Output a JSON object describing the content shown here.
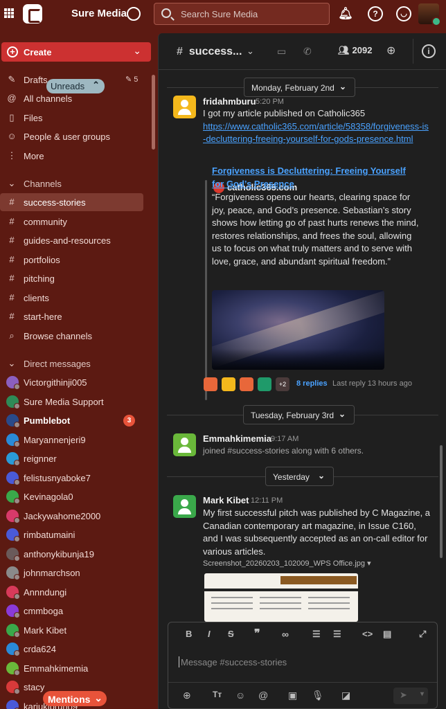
{
  "app": {
    "team_name": "Sure Media"
  },
  "search": {
    "placeholder": "Search Sure Media"
  },
  "topbar": {
    "notification_icon": "bell-icon",
    "help_label": "?",
    "emoji_icon": "smiley-icon"
  },
  "sidebar": {
    "create_label": "Create",
    "unreads_label": "Unreads",
    "drafts_label": "Drafts",
    "drafts_count": "5",
    "nav": [
      {
        "label": "All channels",
        "icon": "@"
      },
      {
        "label": "Files",
        "icon": "▯"
      },
      {
        "label": "People & user groups",
        "icon": "☺"
      },
      {
        "label": "More",
        "icon": "⋮"
      }
    ],
    "channels_header": "Channels",
    "channels": [
      {
        "label": "success-stories",
        "active": true
      },
      {
        "label": "community"
      },
      {
        "label": "guides-and-resources"
      },
      {
        "label": "portfolios"
      },
      {
        "label": "pitching"
      },
      {
        "label": "clients"
      },
      {
        "label": "start-here"
      }
    ],
    "browse_channels": "Browse channels",
    "dm_header": "Direct messages",
    "dms": [
      {
        "label": "Victorgithinji005",
        "color": "#8b5fbf"
      },
      {
        "label": "Sure Media Support",
        "color": "#2e8b57"
      },
      {
        "label": "Pumblebot",
        "color": "#2a4a8a",
        "bold": true,
        "badge": "3"
      },
      {
        "label": "Maryannenjeri9",
        "color": "#2a8ad8"
      },
      {
        "label": "reignner",
        "color": "#2a9ad8"
      },
      {
        "label": "felistusnyaboke7",
        "color": "#4a5ad8"
      },
      {
        "label": "Kevinagola0",
        "color": "#3aa84a"
      },
      {
        "label": "Jackywahome2000",
        "color": "#d83a6a"
      },
      {
        "label": "rimbatumaini",
        "color": "#4a5ad8"
      },
      {
        "label": "anthonykibunja19",
        "color": "#6a5a5a"
      },
      {
        "label": "johnmarchson",
        "color": "#8a8a8a"
      },
      {
        "label": "Annndungi",
        "color": "#d83a5a"
      },
      {
        "label": "cmmboga",
        "color": "#8a3ad8"
      },
      {
        "label": "Mark Kibet",
        "color": "#3aa84a"
      },
      {
        "label": "crda624",
        "color": "#2a8ad8"
      },
      {
        "label": "Emmahkimemia",
        "color": "#6ab83a"
      },
      {
        "label": "stacy",
        "color": "#d83a3a"
      },
      {
        "label": "kariukibruno9",
        "color": "#4a5ad8"
      }
    ],
    "mentions_label": "Mentions"
  },
  "channel": {
    "name": "success...",
    "member_count": "2092"
  },
  "dates": [
    "Monday, February 2nd",
    "Tuesday, February 3rd",
    "Yesterday"
  ],
  "posts": [
    {
      "user": "fridahmburu",
      "time": "5:20 PM",
      "text": "I got my article published on Catholic365",
      "link": "https://www.catholic365.com/article/58358/forgiveness-is-decluttering-freeing-yourself-for-gods-presence.html",
      "preview": {
        "site": "catholic365.com",
        "title": "Forgiveness is Decluttering: Freeing Yourself for God’s Presence",
        "description": "“Forgiveness opens our hearts, clearing space for joy, peace, and God’s presence. Sebastian’s story shows how letting go of past hurts renews the mind, restores relationships, and frees the soul, allowing us to focus on what truly matters and to serve with love, grace, and abundant spiritual freedom.”"
      },
      "reply_extra": "+2",
      "replies": "8 replies",
      "last_reply": "Last reply 13 hours ago"
    },
    {
      "user": "Emmahkimemia",
      "time": "9:17 AM",
      "text": "joined #success-stories along with 6 others."
    },
    {
      "user": "Mark Kibet",
      "time": "12:11 PM",
      "text": "My first successful pitch was published by C Magazine, a Canadian contemporary art magazine, in Issue C160, and I was subsequently accepted as an on-call editor for various articles.",
      "file": "Screenshot_20260203_102009_WPS Office.jpg"
    }
  ],
  "composer": {
    "placeholder": "Message #success-stories"
  },
  "colors": {
    "sidebar": "#5c1a12",
    "accent": "#cc3131",
    "link": "#4aa2ff",
    "mention_badge": "#e8533a"
  }
}
